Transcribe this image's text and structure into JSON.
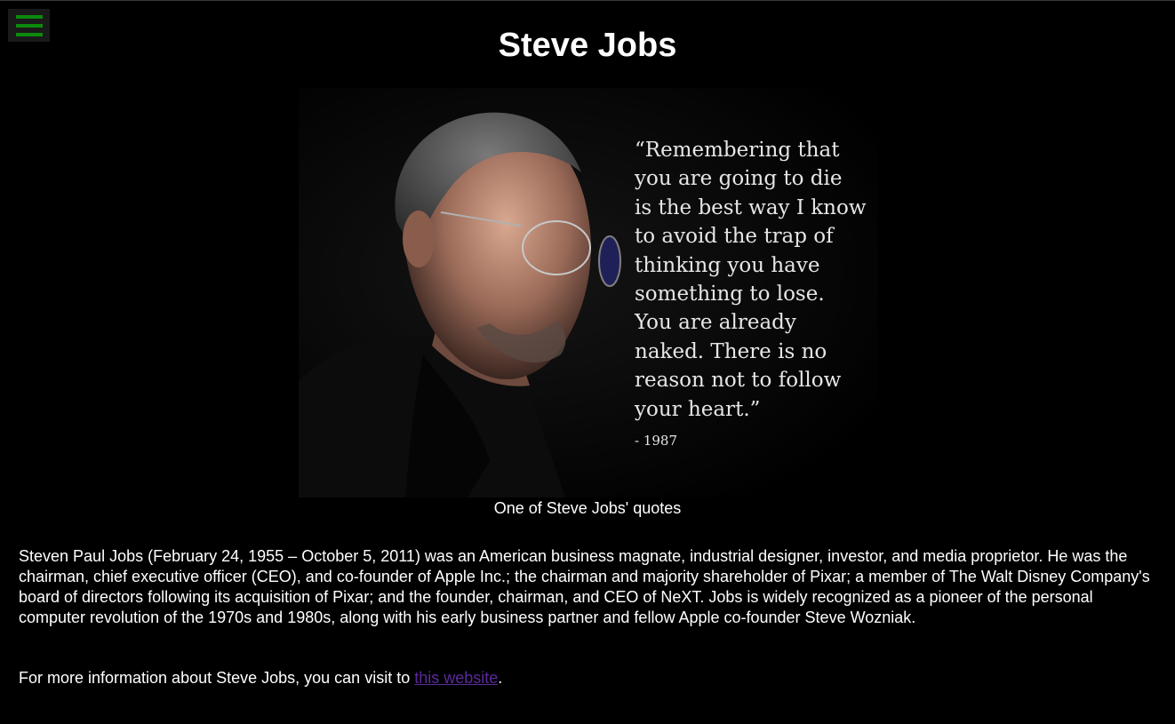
{
  "header": {
    "title": "Steve Jobs",
    "menu_icon": "hamburger-menu-icon",
    "menu_color": "#0d8a0d"
  },
  "figure": {
    "quote_lines": [
      "“Remembering that",
      "you are going to die",
      "is the best way I know",
      "to avoid the trap of",
      "thinking you have",
      "something to lose.",
      "You are already",
      "naked. There is no",
      "reason not to follow",
      "your heart.”"
    ],
    "quote_year": "- 1987",
    "caption": "One of Steve Jobs' quotes"
  },
  "content": {
    "bio": "Steven Paul Jobs (February 24, 1955 – October 5, 2011) was an American business magnate, industrial designer, investor, and media proprietor. He was the chairman, chief executive officer (CEO), and co-founder of Apple Inc.; the chairman and majority shareholder of Pixar; a member of The Walt Disney Company's board of directors following its acquisition of Pixar; and the founder, chairman, and CEO of NeXT. Jobs is widely recognized as a pioneer of the personal computer revolution of the 1970s and 1980s, along with his early business partner and fellow Apple co-founder Steve Wozniak.",
    "more_prefix": "For more information about Steve Jobs, you can visit to ",
    "link_text": "this website",
    "more_suffix": ".",
    "link_color": "#5a2a9a"
  }
}
